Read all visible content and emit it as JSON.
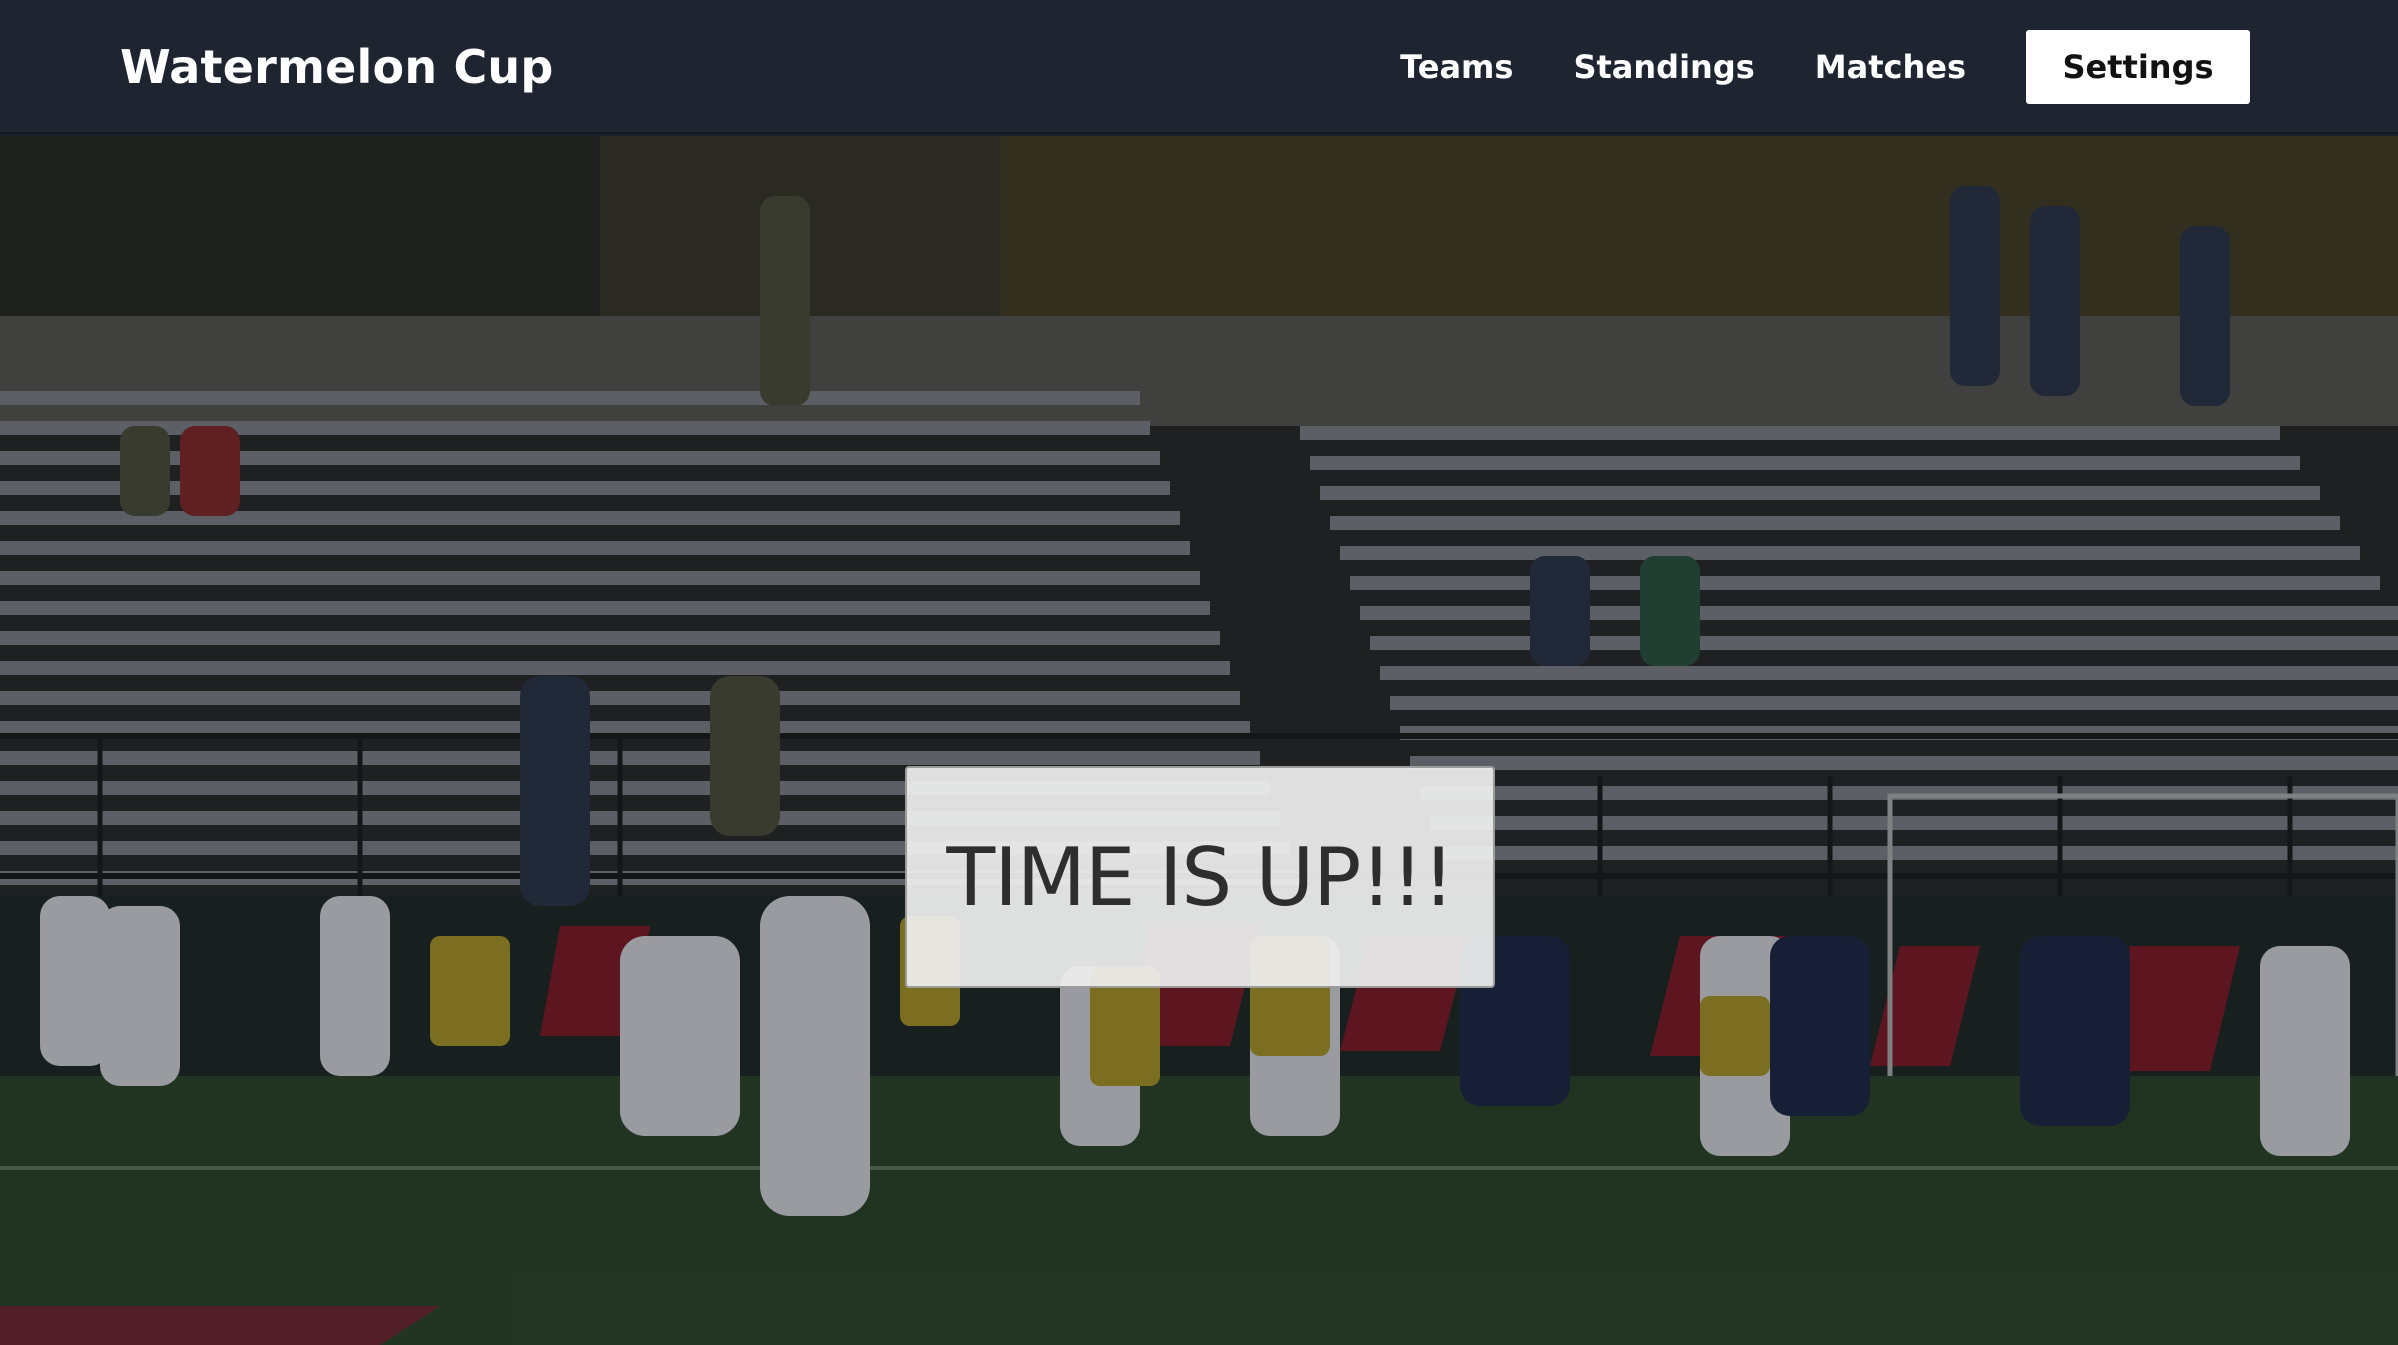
{
  "app": {
    "title": "Watermelon Cup"
  },
  "nav": {
    "items": [
      {
        "label": "Teams"
      },
      {
        "label": "Standings"
      },
      {
        "label": "Matches"
      }
    ],
    "settings_label": "Settings"
  },
  "hero": {
    "image_icon": "stadium-photo-icon"
  },
  "modal": {
    "message": "TIME IS UP!!!"
  },
  "colors": {
    "navbar": "#1e2430",
    "nav_text": "#ffffff",
    "settings_button_bg": "#ffffff",
    "modal_bg": "#eeeeee",
    "modal_text": "#2e2e2e"
  }
}
